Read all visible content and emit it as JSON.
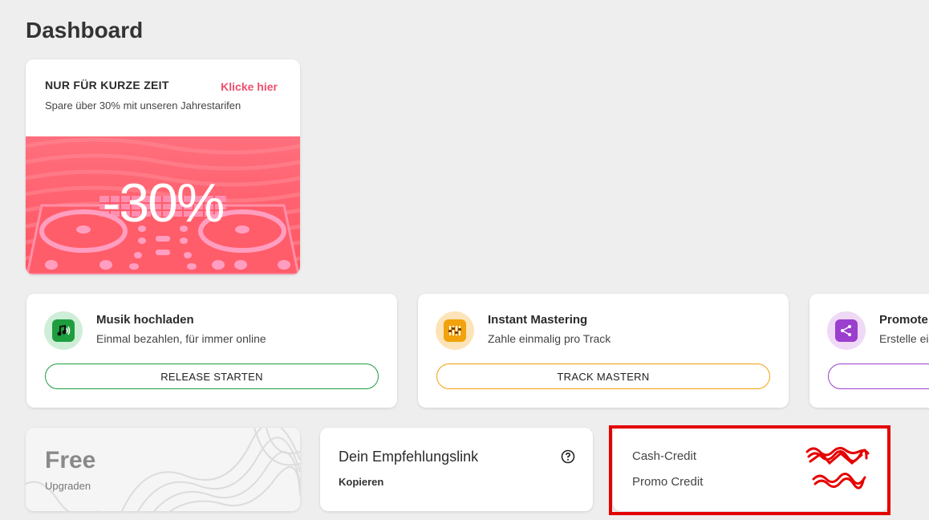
{
  "page": {
    "title": "Dashboard"
  },
  "promo": {
    "title": "NUR FÜR KURZE ZEIT",
    "link": "Klicke hier",
    "subtitle": "Spare über 30% mit unseren Jahrestarifen",
    "discount": "-30%"
  },
  "actions": [
    {
      "title": "Musik hochladen",
      "subtitle": "Einmal bezahlen, für immer online",
      "button": "RELEASE STARTEN",
      "icon": "music-upload-icon",
      "color": "#1e9e3e",
      "bubble": "#cfeed8"
    },
    {
      "title": "Instant Mastering",
      "subtitle": "Zahle einmalig pro Track",
      "button": "TRACK MASTERN",
      "icon": "mastering-icon",
      "color": "#f2a20c",
      "bubble": "#fde3b8"
    },
    {
      "title": "Promote",
      "subtitle": "Erstelle ein",
      "button": "",
      "icon": "share-icon",
      "color": "#9b3fcf",
      "bubble": "#efd9f7"
    }
  ],
  "plan": {
    "name": "Free",
    "upgrade": "Upgraden"
  },
  "referral": {
    "title": "Dein Empfehlungslink",
    "copy": "Kopieren",
    "help_icon": "help-circle-icon"
  },
  "credits": {
    "cash_label": "Cash-Credit",
    "promo_label": "Promo Credit",
    "redaction_color": "#e50000"
  }
}
